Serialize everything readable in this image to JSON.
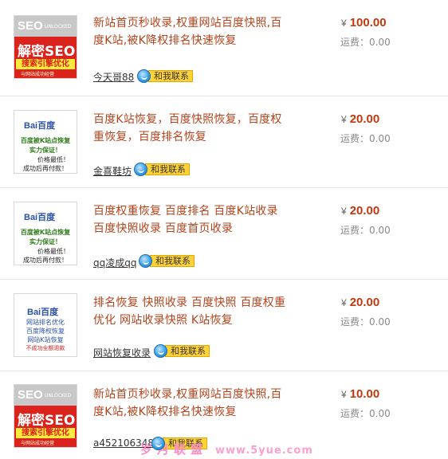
{
  "listings": [
    {
      "title": "新站首页秒收录,权重网站百度快照,百度K站,被K降权排名快速恢复",
      "price": "100.00",
      "currency": "¥",
      "shipping": "运费：0.00",
      "seller": "今天哥88",
      "contact": "和我联系",
      "thumb": {
        "line1": "SEO",
        "line2": "UNLOCKED",
        "line3": "解密SEO",
        "line4": "搜索引擎优化",
        "line5": "与网站成功经营"
      }
    },
    {
      "title": "百度K站恢复，百度快照恢复，百度权重恢复，百度排名恢复",
      "price": "20.00",
      "currency": "¥",
      "shipping": "运费：0.00",
      "seller": "金喜鞋坊",
      "contact": "和我联系",
      "thumb": {
        "logo": "Bai百度",
        "l1": "百度被K站点恢复",
        "l2": "实力保证！",
        "l3": "价格最低！",
        "l4": "成功后再付款！"
      }
    },
    {
      "title": "百度权重恢复 百度排名 百度K站收录 百度快照收录 百度首页收录",
      "price": "20.00",
      "currency": "¥",
      "shipping": "运费：0.00",
      "seller": "qq凌成qq",
      "contact": "和我联系",
      "thumb": {
        "logo": "Bai百度",
        "l1": "百度被K站点恢复",
        "l2": "实力保证！",
        "l3": "价格最低！",
        "l4": "成功后再付款！"
      }
    },
    {
      "title": "排名恢复 快照收录 百度快照 百度权重优化 网站收录快照 K站恢复",
      "price": "20.00",
      "currency": "¥",
      "shipping": "运费：0.00",
      "seller": "网站恢复收录",
      "contact": "和我联系",
      "thumb": {
        "logo": "Bai百度",
        "l1": "网站排名优化",
        "l2": "百度降权恢复",
        "l3": "网站K站恢复",
        "l4": "不成功全额退款"
      }
    },
    {
      "title": "新站首页秒收录,权重网站百度快照,百度K站,被K降权排名快速恢复",
      "price": "10.00",
      "currency": "¥",
      "shipping": "运费：0.00",
      "seller": "a452106348",
      "contact": "和我联系",
      "thumb": {
        "line1": "SEO",
        "line2": "UNLOCKED",
        "line3": "解密SEO",
        "line4": "搜索引擎优化",
        "line5": "与网站成功经营"
      }
    }
  ],
  "watermark": {
    "cn": "岁月联盟",
    "url": "www.5yue.com"
  }
}
